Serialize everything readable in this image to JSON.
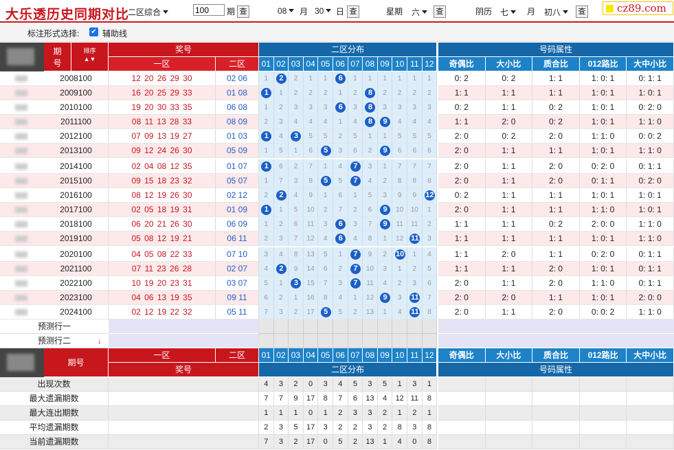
{
  "title": "大乐透历史同期对比",
  "filters": {
    "zone": "二区综合",
    "periods": "100",
    "period_label": "期",
    "month": "08",
    "month_label": "月",
    "day": "30",
    "day_label": "日",
    "weekday_label": "星期",
    "weekday": "六",
    "lunar_label": "阴历",
    "lunar_month": "七",
    "lunar_month_label": "月",
    "lunar_day": "初八",
    "query": "查"
  },
  "logo": "cz89.com",
  "options": {
    "label": "标注形式选择:",
    "aux_line": "辅助线",
    "checked": "✔"
  },
  "header": {
    "issue": "期号",
    "sort": "排序",
    "prize": "奖号",
    "zone1": "一区",
    "zone2": "二区",
    "dist": "二区分布",
    "attr": "号码属性",
    "nums": [
      "01",
      "02",
      "03",
      "04",
      "05",
      "06",
      "07",
      "08",
      "09",
      "10",
      "11",
      "12"
    ],
    "attrs": [
      "奇偶比",
      "大小比",
      "质合比",
      "012路比",
      "大中小比"
    ]
  },
  "rows": [
    {
      "issue": "2008100",
      "z1": "12 20 26 29 30",
      "z2": "02 06",
      "dist": [
        "1",
        "B",
        "2",
        "1",
        "1",
        "B",
        "1",
        "1",
        "1",
        "1",
        "1",
        "1"
      ],
      "attrs": [
        "0: 2",
        "0: 2",
        "1: 1",
        "1: 0: 1",
        "0: 1: 1"
      ]
    },
    {
      "issue": "2009100",
      "z1": "16 20 25 29 33",
      "z2": "01 08",
      "dist": [
        "B",
        "1",
        "2",
        "2",
        "2",
        "1",
        "2",
        "B",
        "2",
        "2",
        "2",
        "2"
      ],
      "attrs": [
        "1: 1",
        "1: 1",
        "1: 1",
        "1: 0: 1",
        "1: 0: 1"
      ]
    },
    {
      "issue": "2010100",
      "z1": "19 20 30 33 35",
      "z2": "06 08",
      "dist": [
        "1",
        "2",
        "3",
        "3",
        "3",
        "B",
        "3",
        "B",
        "3",
        "3",
        "3",
        "3"
      ],
      "attrs": [
        "0: 2",
        "1: 1",
        "0: 2",
        "1: 0: 1",
        "0: 2: 0"
      ]
    },
    {
      "issue": "2011100",
      "z1": "08 11 13 28 33",
      "z2": "08 09",
      "dist": [
        "2",
        "3",
        "4",
        "4",
        "4",
        "1",
        "4",
        "B",
        "B",
        "4",
        "4",
        "4"
      ],
      "attrs": [
        "1: 1",
        "2: 0",
        "0: 2",
        "1: 0: 1",
        "1: 1: 0"
      ]
    },
    {
      "issue": "2012100",
      "z1": "07 09 13 19 27",
      "z2": "01 03",
      "dist": [
        "B",
        "4",
        "B",
        "5",
        "5",
        "2",
        "5",
        "1",
        "1",
        "5",
        "5",
        "5"
      ],
      "attrs": [
        "2: 0",
        "0: 2",
        "2: 0",
        "1: 1: 0",
        "0: 0: 2"
      ]
    },
    {
      "issue": "2013100",
      "z1": "09 12 24 26 30",
      "z2": "05 09",
      "dist": [
        "1",
        "5",
        "1",
        "6",
        "B",
        "3",
        "6",
        "2",
        "B",
        "6",
        "6",
        "6"
      ],
      "attrs": [
        "2: 0",
        "1: 1",
        "1: 1",
        "1: 0: 1",
        "1: 1: 0"
      ]
    },
    {
      "issue": "2014100",
      "z1": "02 04 08 12 35",
      "z2": "01 07",
      "dist": [
        "B",
        "6",
        "2",
        "7",
        "1",
        "4",
        "B",
        "3",
        "1",
        "7",
        "7",
        "7"
      ],
      "attrs": [
        "2: 0",
        "1: 1",
        "2: 0",
        "0: 2: 0",
        "0: 1: 1"
      ]
    },
    {
      "issue": "2015100",
      "z1": "09 15 18 23 32",
      "z2": "05 07",
      "dist": [
        "1",
        "7",
        "3",
        "8",
        "B",
        "5",
        "B",
        "4",
        "2",
        "8",
        "8",
        "8"
      ],
      "attrs": [
        "2: 0",
        "1: 1",
        "2: 0",
        "0: 1: 1",
        "0: 2: 0"
      ]
    },
    {
      "issue": "2016100",
      "z1": "08 12 19 26 30",
      "z2": "02 12",
      "dist": [
        "2",
        "B",
        "4",
        "9",
        "1",
        "6",
        "1",
        "5",
        "3",
        "9",
        "9",
        "B"
      ],
      "attrs": [
        "0: 2",
        "1: 1",
        "1: 1",
        "1: 0: 1",
        "1: 0: 1"
      ]
    },
    {
      "issue": "2017100",
      "z1": "02 05 18 19 31",
      "z2": "01 09",
      "dist": [
        "B",
        "1",
        "5",
        "10",
        "2",
        "7",
        "2",
        "6",
        "B",
        "10",
        "10",
        "1"
      ],
      "attrs": [
        "2: 0",
        "1: 1",
        "1: 1",
        "1: 1: 0",
        "1: 0: 1"
      ]
    },
    {
      "issue": "2018100",
      "z1": "06 20 21 26 30",
      "z2": "06 09",
      "dist": [
        "1",
        "2",
        "6",
        "11",
        "3",
        "B",
        "3",
        "7",
        "B",
        "11",
        "11",
        "2"
      ],
      "attrs": [
        "1: 1",
        "1: 1",
        "0: 2",
        "2: 0: 0",
        "1: 1: 0"
      ]
    },
    {
      "issue": "2019100",
      "z1": "05 08 12 19 21",
      "z2": "06 11",
      "dist": [
        "2",
        "3",
        "7",
        "12",
        "4",
        "B",
        "4",
        "8",
        "1",
        "12",
        "B",
        "3"
      ],
      "attrs": [
        "1: 1",
        "1: 1",
        "1: 1",
        "1: 0: 1",
        "1: 1: 0"
      ]
    },
    {
      "issue": "2020100",
      "z1": "04 05 08 22 33",
      "z2": "07 10",
      "dist": [
        "3",
        "4",
        "8",
        "13",
        "5",
        "1",
        "B",
        "9",
        "2",
        "B",
        "1",
        "4"
      ],
      "attrs": [
        "1: 1",
        "2: 0",
        "1: 1",
        "0: 2: 0",
        "0: 1: 1"
      ]
    },
    {
      "issue": "2021100",
      "z1": "07 11 23 26 28",
      "z2": "02 07",
      "dist": [
        "4",
        "B",
        "9",
        "14",
        "6",
        "2",
        "B",
        "10",
        "3",
        "1",
        "2",
        "5"
      ],
      "attrs": [
        "1: 1",
        "1: 1",
        "2: 0",
        "1: 0: 1",
        "0: 1: 1"
      ]
    },
    {
      "issue": "2022100",
      "z1": "10 19 20 23 31",
      "z2": "03 07",
      "dist": [
        "5",
        "1",
        "B",
        "15",
        "7",
        "3",
        "B",
        "11",
        "4",
        "2",
        "3",
        "6"
      ],
      "attrs": [
        "2: 0",
        "1: 1",
        "2: 0",
        "1: 1: 0",
        "0: 1: 1"
      ]
    },
    {
      "issue": "2023100",
      "z1": "04 06 13 19 35",
      "z2": "09 11",
      "dist": [
        "6",
        "2",
        "1",
        "16",
        "8",
        "4",
        "1",
        "12",
        "B",
        "3",
        "B",
        "7"
      ],
      "attrs": [
        "2: 0",
        "2: 0",
        "1: 1",
        "1: 0: 1",
        "2: 0: 0"
      ]
    },
    {
      "issue": "2024100",
      "z1": "02 12 19 22 32",
      "z2": "05 11",
      "dist": [
        "7",
        "3",
        "2",
        "17",
        "B",
        "5",
        "2",
        "13",
        "1",
        "4",
        "B",
        "8"
      ],
      "attrs": [
        "2: 0",
        "1: 1",
        "2: 0",
        "0: 0: 2",
        "1: 1: 0"
      ]
    }
  ],
  "predict": [
    "预测行一",
    "预测行二"
  ],
  "stats": [
    {
      "label": "出现次数",
      "vals": [
        "4",
        "3",
        "2",
        "0",
        "3",
        "4",
        "5",
        "3",
        "5",
        "1",
        "3",
        "1"
      ]
    },
    {
      "label": "最大遗漏期数",
      "vals": [
        "7",
        "7",
        "9",
        "17",
        "8",
        "7",
        "6",
        "13",
        "4",
        "12",
        "11",
        "8"
      ]
    },
    {
      "label": "最大连出期数",
      "vals": [
        "1",
        "1",
        "1",
        "0",
        "1",
        "2",
        "3",
        "3",
        "2",
        "1",
        "2",
        "1"
      ]
    },
    {
      "label": "平均遗漏期数",
      "vals": [
        "2",
        "3",
        "5",
        "17",
        "3",
        "2",
        "2",
        "3",
        "2",
        "8",
        "3",
        "8"
      ]
    },
    {
      "label": "当前遗漏期数",
      "vals": [
        "7",
        "3",
        "2",
        "17",
        "0",
        "5",
        "2",
        "13",
        "1",
        "4",
        "0",
        "8"
      ]
    }
  ],
  "colors": {
    "red": "#c8161d",
    "blue": "#1e82c8",
    "ball": "#1c5fc8",
    "pink": "#fde9ea",
    "lightblue": "#ddeefa"
  }
}
